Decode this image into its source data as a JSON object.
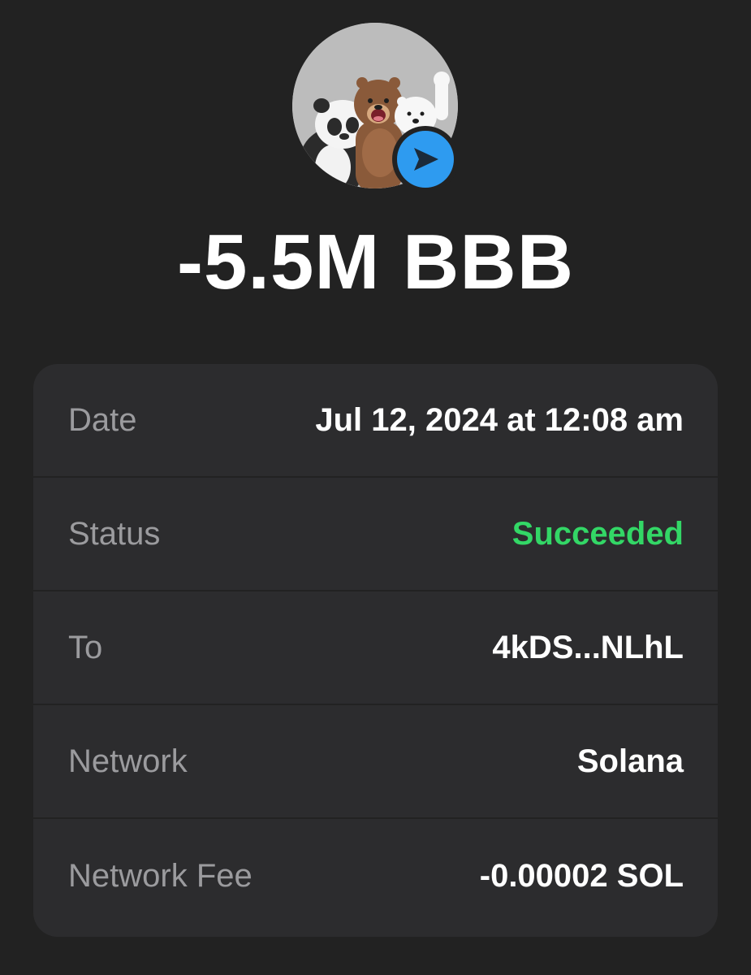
{
  "header": {
    "avatar_icon": "token-avatar-bears",
    "badge_icon": "send-arrow-icon",
    "amount": "-5.5M BBB"
  },
  "details": [
    {
      "label": "Date",
      "value": "Jul 12, 2024 at 12:08 am"
    },
    {
      "label": "Status",
      "value": "Succeeded"
    },
    {
      "label": "To",
      "value": "4kDS...NLhL"
    },
    {
      "label": "Network",
      "value": "Solana"
    },
    {
      "label": "Network Fee",
      "value": "-0.00002 SOL"
    }
  ],
  "colors": {
    "background": "#222222",
    "card": "#2c2c2e",
    "success": "#33d766",
    "badge": "#2e9bf0",
    "label": "#9b9b9e"
  }
}
